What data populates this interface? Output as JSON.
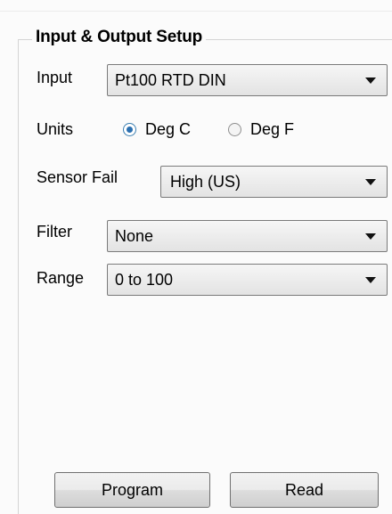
{
  "group": {
    "title": "Input & Output Setup"
  },
  "input": {
    "label": "Input",
    "value": "Pt100 RTD DIN"
  },
  "units": {
    "label": "Units",
    "options": [
      {
        "label": "Deg C",
        "checked": true
      },
      {
        "label": "Deg F",
        "checked": false
      }
    ]
  },
  "sensor_fail": {
    "label": "Sensor Fail",
    "value": "High (US)"
  },
  "filter": {
    "label": "Filter",
    "value": "None"
  },
  "range": {
    "label": "Range",
    "value": "0 to 100"
  },
  "buttons": {
    "program": "Program",
    "read": "Read"
  }
}
